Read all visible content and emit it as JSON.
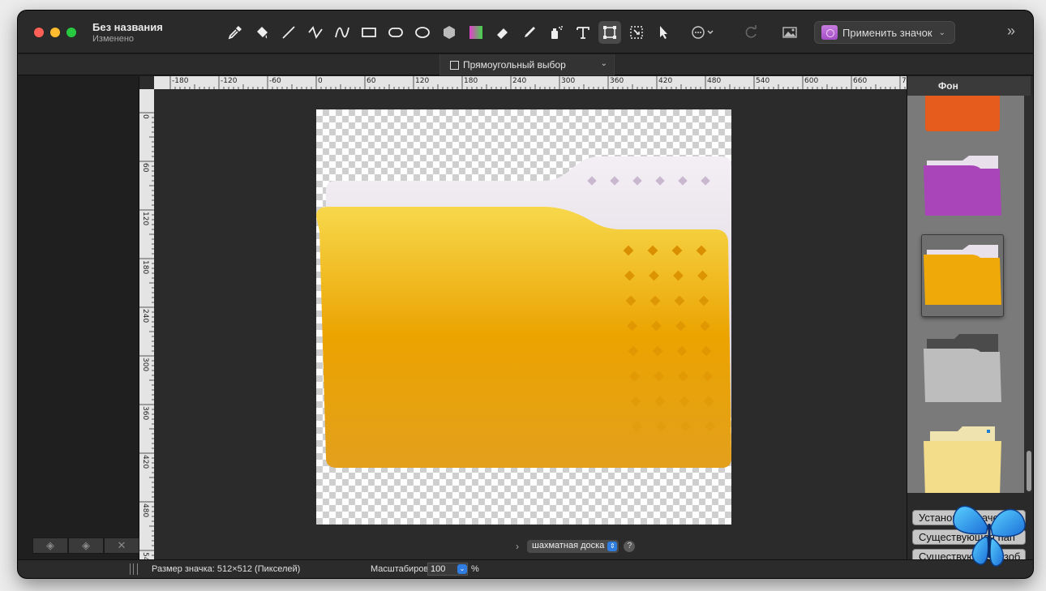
{
  "window": {
    "title": "Без названия",
    "subtitle": "Изменено"
  },
  "toolbar": {
    "tools": [
      {
        "name": "eyedropper-tool-icon"
      },
      {
        "name": "fill-bucket-tool-icon"
      },
      {
        "name": "line-tool-icon"
      },
      {
        "name": "polyline-tool-icon"
      },
      {
        "name": "curve-tool-icon"
      },
      {
        "name": "rectangle-tool-icon"
      },
      {
        "name": "rounded-rect-tool-icon"
      },
      {
        "name": "ellipse-tool-icon"
      },
      {
        "name": "polygon-tool-icon"
      },
      {
        "name": "gradient-tool-icon"
      },
      {
        "name": "eraser-tool-icon"
      },
      {
        "name": "pencil-tool-icon"
      },
      {
        "name": "spray-tool-icon"
      },
      {
        "name": "text-tool-icon"
      },
      {
        "name": "rect-select-tool-icon"
      },
      {
        "name": "magic-select-tool-icon"
      },
      {
        "name": "pointer-tool-icon"
      },
      {
        "name": "more-options-icon"
      },
      {
        "name": "redo-icon"
      },
      {
        "name": "image-icon"
      }
    ],
    "selected_tool": "rect-select-tool-icon",
    "apply_label": "Применить значок",
    "overflow_label": "»"
  },
  "subbar": {
    "mode_label": "Прямоугольный выбор"
  },
  "rulers": {
    "top_labels": [
      "-180",
      "-120",
      "-60",
      "0",
      "60",
      "120",
      "180",
      "240",
      "300",
      "360",
      "420",
      "480",
      "540",
      "600",
      "660",
      "7"
    ],
    "left_labels": [
      "0",
      "60",
      "120",
      "180",
      "240",
      "300",
      "360",
      "420",
      "480",
      "54"
    ]
  },
  "canvas": {
    "background_option": "шахматная доска",
    "help_label": "?"
  },
  "right_panel": {
    "header": "Фон",
    "buttons": [
      "Установить качест",
      "Существующая пап",
      "Существующее изоб"
    ]
  },
  "status": {
    "size_text": "Размер значка: 512×512 (Пикселей)",
    "zoom_label": "Масштабирование",
    "zoom_value": "100",
    "percent": "%"
  },
  "colors": {
    "accent": "#2f7de1",
    "folder_yellow": "#f2b01e",
    "folder_paper": "#e9e3ea"
  }
}
